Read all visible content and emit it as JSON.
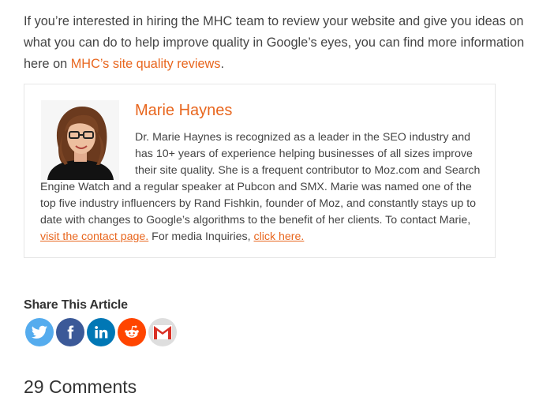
{
  "intro": {
    "text": "If you’re interested in hiring the MHC team to review your website and give you ideas on what you can do to help improve quality in Google’s eyes, you can find more information here on ",
    "link": "MHC’s site quality reviews",
    "end": "."
  },
  "author": {
    "name": "Marie Haynes",
    "bio": "Dr. Marie Haynes is recognized as a leader in the SEO industry and has 10+ years of experience helping businesses of all sizes improve their site quality. She is a frequent contributor to Moz.com and Search Engine Watch and a regular speaker at Pubcon and SMX. Marie was named one of the top five industry influencers by Rand Fishkin, founder of Moz, and constantly stays up to date with changes to Google’s algorithms to the benefit of her clients. To contact Marie, ",
    "contact_link": "visit the contact page.",
    "media_text": " For media Inquiries, ",
    "media_link": "click here."
  },
  "share": {
    "title": "Share This Article",
    "icons": [
      "twitter-icon",
      "facebook-icon",
      "linkedin-icon",
      "reddit-icon",
      "gmail-icon"
    ],
    "colors": {
      "twitter": "#55acee",
      "facebook": "#3b5998",
      "linkedin": "#0077b5",
      "reddit": "#ff4500",
      "gmail": "#dedede"
    }
  },
  "comments": {
    "title": "29 Comments"
  },
  "colors": {
    "accent": "#e8661e",
    "text": "#444444",
    "border": "#e6e6e6"
  }
}
